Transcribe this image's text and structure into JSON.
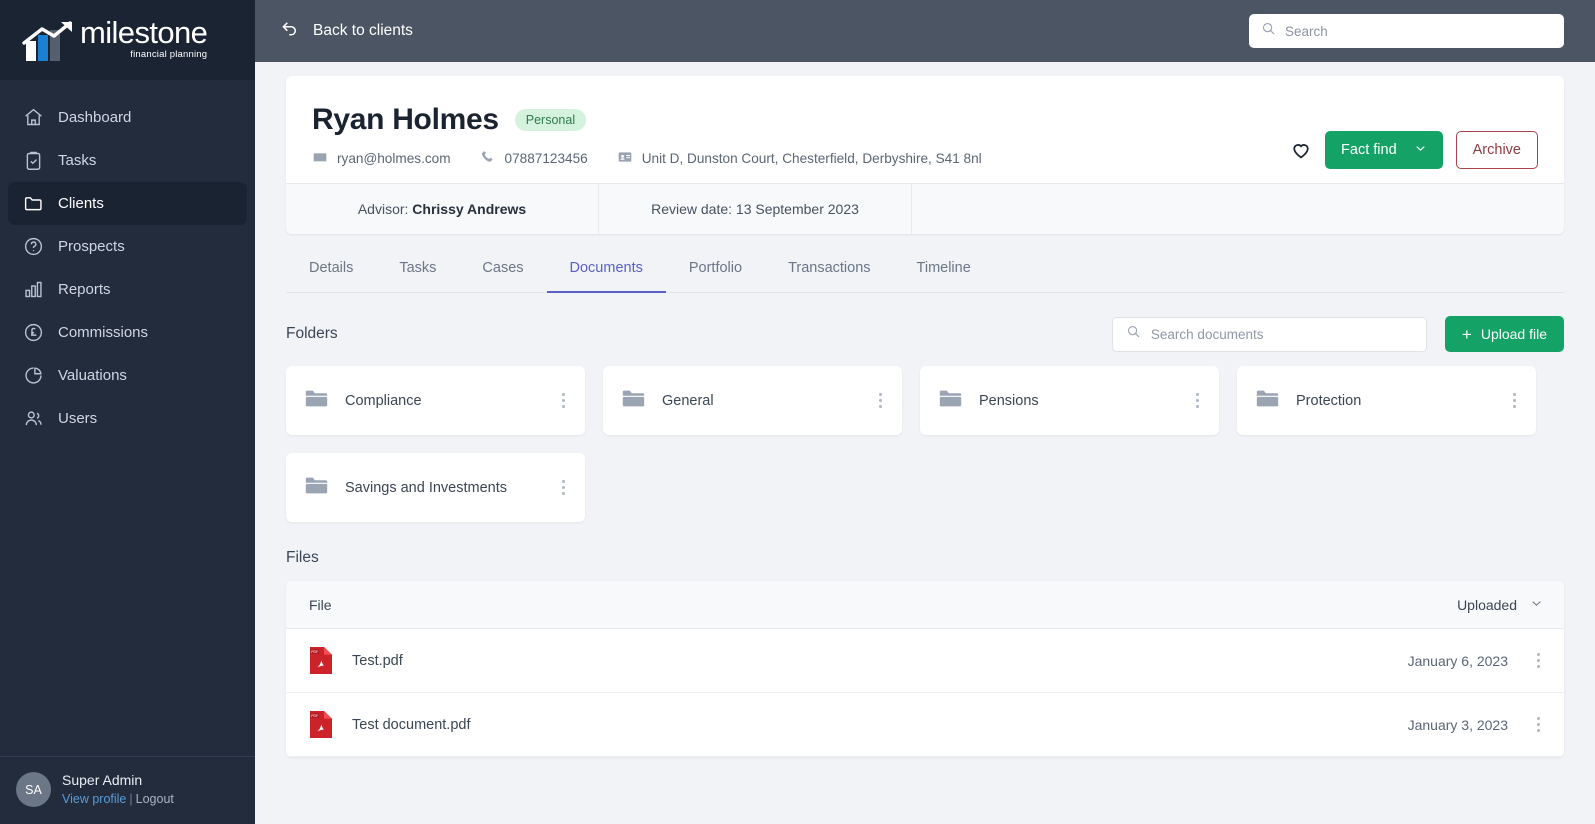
{
  "sidebar": {
    "logo": {
      "word": "milestone",
      "sub": "financial planning"
    },
    "items": [
      {
        "label": "Dashboard",
        "icon": "home-icon",
        "active": false
      },
      {
        "label": "Tasks",
        "icon": "clipboard-check-icon",
        "active": false
      },
      {
        "label": "Clients",
        "icon": "folder-icon",
        "active": true
      },
      {
        "label": "Prospects",
        "icon": "question-circle-icon",
        "active": false
      },
      {
        "label": "Reports",
        "icon": "bar-chart-icon",
        "active": false
      },
      {
        "label": "Commissions",
        "icon": "pound-circle-icon",
        "active": false
      },
      {
        "label": "Valuations",
        "icon": "pie-chart-icon",
        "active": false
      },
      {
        "label": "Users",
        "icon": "users-icon",
        "active": false
      }
    ],
    "user": {
      "initials": "SA",
      "name": "Super Admin",
      "view_profile": "View profile",
      "separator": "|",
      "logout": "Logout"
    }
  },
  "topbar": {
    "back_label": "Back to clients",
    "search_placeholder": "Search",
    "search_value": ""
  },
  "client": {
    "name": "Ryan Holmes",
    "badge": "Personal",
    "email": "ryan@holmes.com",
    "phone": "07887123456",
    "address": "Unit D, Dunston Court, Chesterfield, Derbyshire, S41 8nl",
    "fact_find_label": "Fact find",
    "archive_label": "Archive",
    "advisor_label": "Advisor: ",
    "advisor_name": "Chrissy Andrews",
    "review_label": "Review date: 13 September 2023"
  },
  "tabs": [
    {
      "label": "Details",
      "active": false
    },
    {
      "label": "Tasks",
      "active": false
    },
    {
      "label": "Cases",
      "active": false
    },
    {
      "label": "Documents",
      "active": true
    },
    {
      "label": "Portfolio",
      "active": false
    },
    {
      "label": "Transactions",
      "active": false
    },
    {
      "label": "Timeline",
      "active": false
    }
  ],
  "documents": {
    "folders_title": "Folders",
    "search_placeholder": "Search documents",
    "search_value": "",
    "upload_label": "Upload file",
    "folders": [
      {
        "name": "Compliance"
      },
      {
        "name": "General"
      },
      {
        "name": "Pensions"
      },
      {
        "name": "Protection"
      },
      {
        "name": "Savings and Investments"
      }
    ],
    "files_title": "Files",
    "columns": {
      "file": "File",
      "uploaded": "Uploaded"
    },
    "files": [
      {
        "name": "Test.pdf",
        "uploaded": "January 6, 2023",
        "type": "pdf"
      },
      {
        "name": "Test document.pdf",
        "uploaded": "January 3, 2023",
        "type": "pdf"
      }
    ]
  },
  "colors": {
    "sidebar_bg": "#222c3c",
    "topbar_bg": "#4b5563",
    "accent_green": "#15a266",
    "accent_purple": "#5b5fc7",
    "archive_red": "#a8444b",
    "badge_bg": "#d5f2de",
    "badge_text": "#2f7a4e",
    "pdf_red": "#cc2229"
  }
}
